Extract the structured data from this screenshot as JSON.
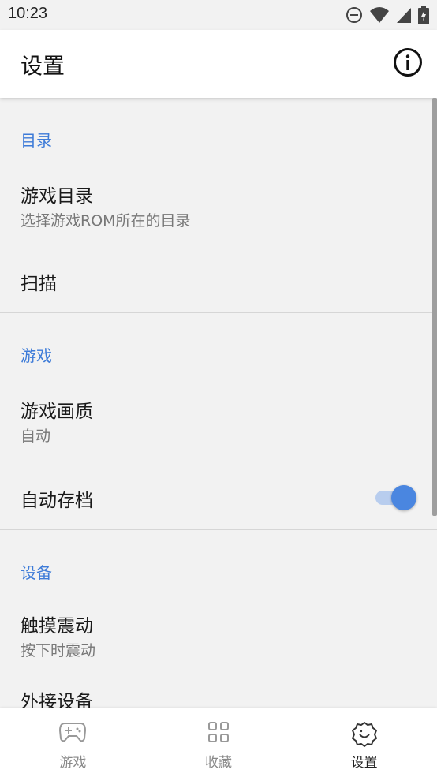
{
  "status_bar": {
    "time": "10:23",
    "icons": [
      "do-not-disturb-icon",
      "wifi-icon",
      "signal-icon",
      "battery-charging-icon"
    ]
  },
  "app_bar": {
    "title": "设置",
    "info_icon": "info-icon"
  },
  "sections": {
    "directory": {
      "header": "目录",
      "game_dir": {
        "title": "游戏目录",
        "subtitle": "选择游戏ROM所在的目录"
      },
      "scan": {
        "title": "扫描"
      }
    },
    "game": {
      "header": "游戏",
      "quality": {
        "title": "游戏画质",
        "subtitle": "自动"
      },
      "autosave": {
        "title": "自动存档",
        "enabled": true
      }
    },
    "device": {
      "header": "设备",
      "vibration": {
        "title": "触摸震动",
        "subtitle": "按下时震动"
      },
      "external": {
        "title": "外接设备"
      }
    }
  },
  "bottom_nav": {
    "games": {
      "label": "游戏",
      "icon": "gamepad-icon"
    },
    "favorites": {
      "label": "收藏",
      "icon": "grid-icon"
    },
    "settings": {
      "label": "设置",
      "icon": "settings-icon",
      "active": true
    }
  },
  "colors": {
    "accent": "#3d7bd8",
    "toggle_thumb": "#4a86e0",
    "toggle_track": "#b8cdee",
    "background": "#f2f2f2"
  }
}
